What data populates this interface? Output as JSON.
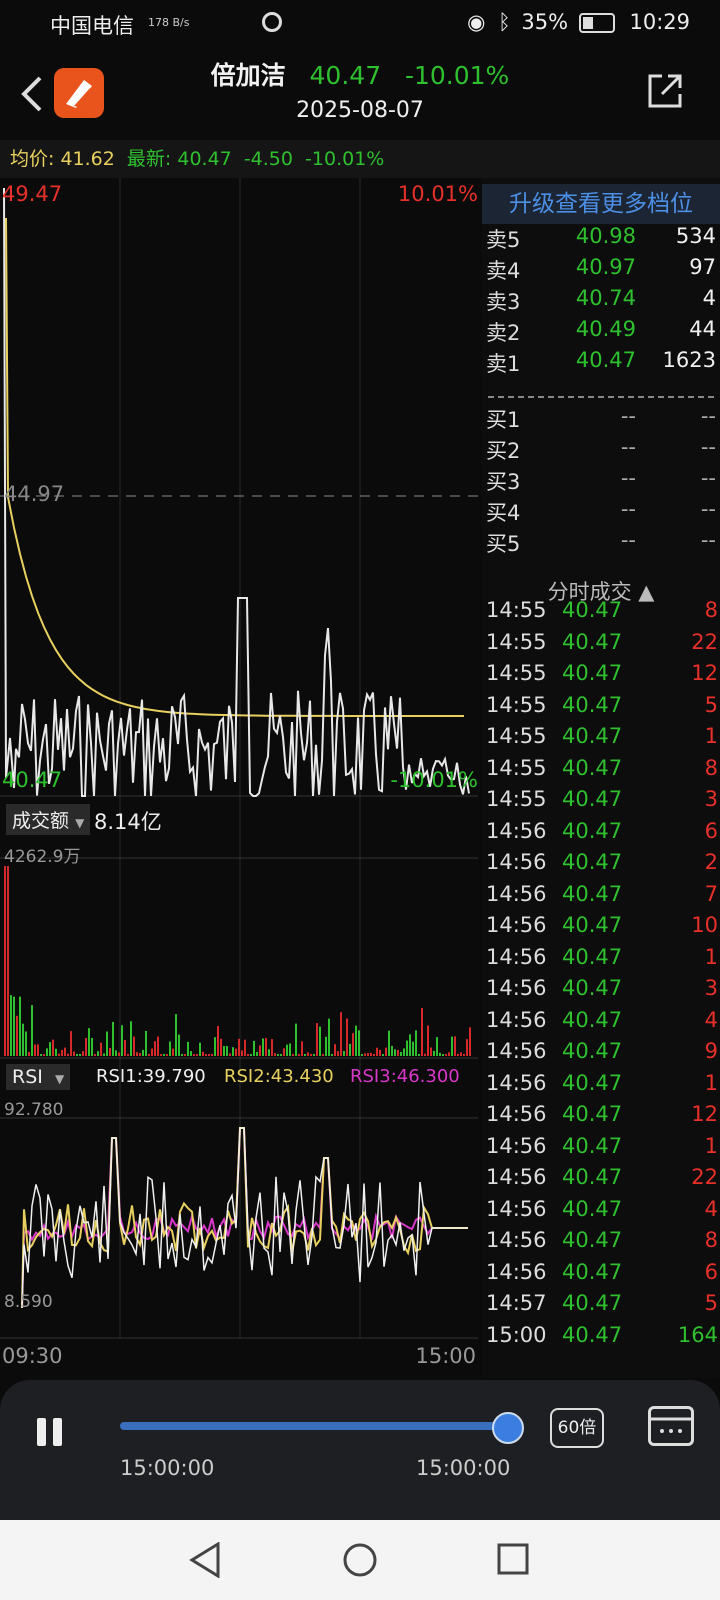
{
  "status_bar": {
    "carrier": "中国电信",
    "net_speed": "178 B/s",
    "battery": "35%",
    "time": "10:29"
  },
  "header": {
    "stock_name": "倍加洁",
    "price": "40.47",
    "change_pct": "-10.01%",
    "date": "2025-08-07"
  },
  "info_line": {
    "avg_label": "均价:",
    "avg_value": "41.62",
    "latest_label": "最新:",
    "latest_value": "40.47",
    "change": "-4.50",
    "change_pct": "-10.01%"
  },
  "price_chart": {
    "high_label": "49.47",
    "high_pct": "10.01%",
    "mid_label": "44.97",
    "low_label": "40.47",
    "low_pct": "-10.01%",
    "colors": {
      "price_line": "#e8e8e8",
      "avg_line": "#e8d060"
    }
  },
  "volume_panel": {
    "indicator": "成交额",
    "total": "8.14亿",
    "max_label": "4262.9万"
  },
  "rsi_panel": {
    "indicator": "RSI",
    "rsi1": "RSI1:39.790",
    "rsi2": "RSI2:43.430",
    "rsi3": "RSI3:46.300",
    "max_label": "92.780",
    "min_label": "8.590",
    "colors": {
      "rsi1": "#f0f0f0",
      "rsi2": "#e8d060",
      "rsi3": "#d838c8"
    }
  },
  "time_axis": {
    "start": "09:30",
    "end": "15:00"
  },
  "orderbook": {
    "upgrade_label": "升级查看更多档位",
    "asks": [
      {
        "label": "卖5",
        "price": "40.98",
        "volume": "534"
      },
      {
        "label": "卖4",
        "price": "40.97",
        "volume": "97"
      },
      {
        "label": "卖3",
        "price": "40.74",
        "volume": "4"
      },
      {
        "label": "卖2",
        "price": "40.49",
        "volume": "44"
      },
      {
        "label": "卖1",
        "price": "40.47",
        "volume": "1623"
      }
    ],
    "bids": [
      {
        "label": "买1",
        "price": "--",
        "volume": "--"
      },
      {
        "label": "买2",
        "price": "--",
        "volume": "--"
      },
      {
        "label": "买3",
        "price": "--",
        "volume": "--"
      },
      {
        "label": "买4",
        "price": "--",
        "volume": "--"
      },
      {
        "label": "买5",
        "price": "--",
        "volume": "--"
      }
    ]
  },
  "ticks": {
    "title": "分时成交 ▲",
    "rows": [
      {
        "time": "14:55",
        "price": "40.47",
        "vol": "8"
      },
      {
        "time": "14:55",
        "price": "40.47",
        "vol": "22"
      },
      {
        "time": "14:55",
        "price": "40.47",
        "vol": "12"
      },
      {
        "time": "14:55",
        "price": "40.47",
        "vol": "5"
      },
      {
        "time": "14:55",
        "price": "40.47",
        "vol": "1"
      },
      {
        "time": "14:55",
        "price": "40.47",
        "vol": "8"
      },
      {
        "time": "14:55",
        "price": "40.47",
        "vol": "3"
      },
      {
        "time": "14:56",
        "price": "40.47",
        "vol": "6"
      },
      {
        "time": "14:56",
        "price": "40.47",
        "vol": "2"
      },
      {
        "time": "14:56",
        "price": "40.47",
        "vol": "7"
      },
      {
        "time": "14:56",
        "price": "40.47",
        "vol": "10"
      },
      {
        "time": "14:56",
        "price": "40.47",
        "vol": "1"
      },
      {
        "time": "14:56",
        "price": "40.47",
        "vol": "3"
      },
      {
        "time": "14:56",
        "price": "40.47",
        "vol": "4"
      },
      {
        "time": "14:56",
        "price": "40.47",
        "vol": "9"
      },
      {
        "time": "14:56",
        "price": "40.47",
        "vol": "1"
      },
      {
        "time": "14:56",
        "price": "40.47",
        "vol": "12"
      },
      {
        "time": "14:56",
        "price": "40.47",
        "vol": "1"
      },
      {
        "time": "14:56",
        "price": "40.47",
        "vol": "22"
      },
      {
        "time": "14:56",
        "price": "40.47",
        "vol": "4"
      },
      {
        "time": "14:56",
        "price": "40.47",
        "vol": "8"
      },
      {
        "time": "14:56",
        "price": "40.47",
        "vol": "6"
      },
      {
        "time": "14:57",
        "price": "40.47",
        "vol": "5"
      },
      {
        "time": "15:00",
        "price": "40.47",
        "vol": "164"
      }
    ]
  },
  "player": {
    "start_time": "15:00:00",
    "end_time": "15:00:00",
    "speed": "60倍",
    "progress": 1.0
  },
  "icons": [
    "back-icon",
    "app-logo-icon",
    "share-icon",
    "pause-icon",
    "calendar-icon",
    "nav-back-icon",
    "nav-home-icon",
    "nav-recent-icon"
  ]
}
